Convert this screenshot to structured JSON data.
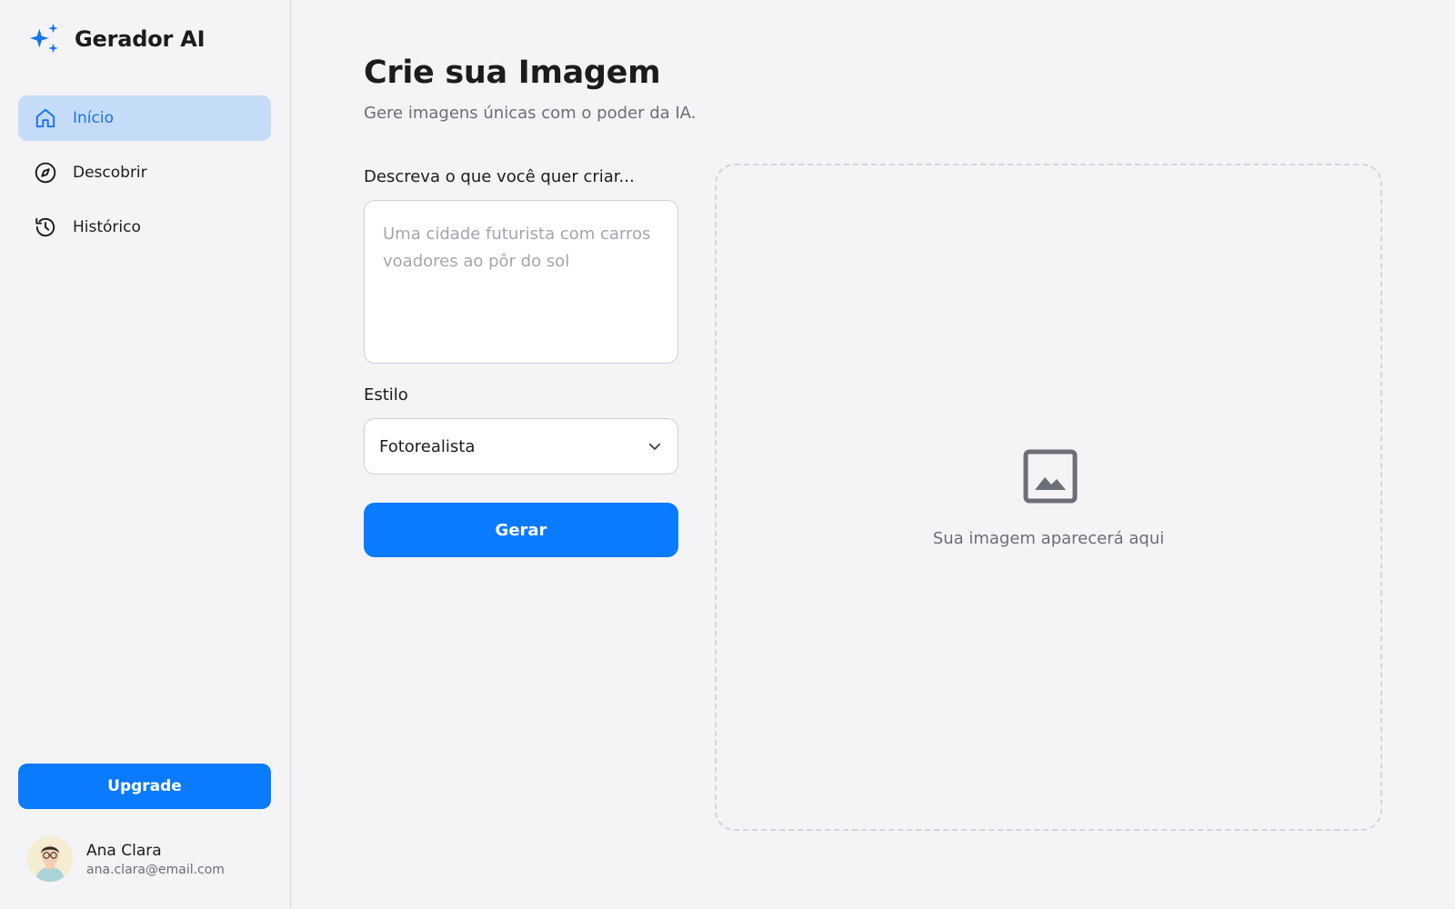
{
  "app": {
    "brand_name": "Gerador AI",
    "brand_icon": "sparkles-icon",
    "accent_color": "#0a7aff"
  },
  "sidebar": {
    "items": [
      {
        "label": "Início",
        "icon": "home-icon",
        "active": true
      },
      {
        "label": "Descobrir",
        "icon": "compass-icon",
        "active": false
      },
      {
        "label": "Histórico",
        "icon": "history-icon",
        "active": false
      }
    ],
    "upgrade_label": "Upgrade",
    "user": {
      "name": "Ana Clara",
      "email": "ana.clara@email.com"
    }
  },
  "main": {
    "title": "Crie sua Imagem",
    "subtitle": "Gere imagens únicas com o poder da IA.",
    "prompt": {
      "label": "Descreva o que você quer criar...",
      "value": "",
      "placeholder": "Uma cidade futurista com carros voadores ao pôr do sol"
    },
    "style": {
      "label": "Estilo",
      "selected": "Fotorealista"
    },
    "generate_label": "Gerar",
    "preview": {
      "icon": "image-icon",
      "text": "Sua imagem aparecerá aqui"
    }
  }
}
